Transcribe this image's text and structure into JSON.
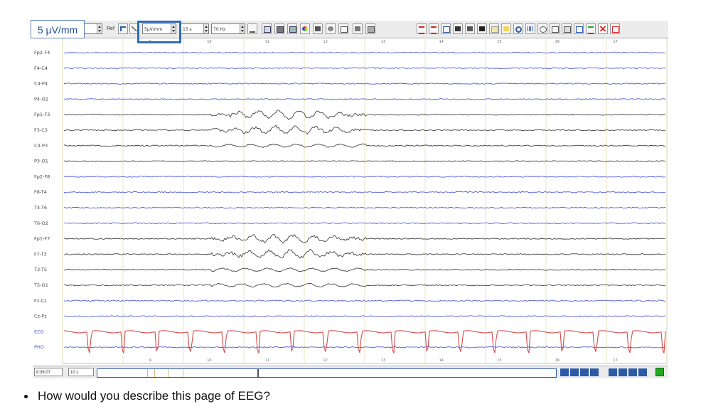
{
  "callout": {
    "sensitivity": "5 µV/mm"
  },
  "toolbar": {
    "ref_label": "Ref",
    "sensitivity_value": "5µV/mm",
    "timebase_value": "15 s",
    "filter_value": "70 Hz",
    "icons": [
      "ref-montage-icon",
      "electrode-icon",
      "page-view-icon",
      "split-view-icon",
      "grid-view-icon",
      "color-wheel-icon",
      "film-icon",
      "clock-icon",
      "edit-icon",
      "save-icon",
      "print-icon",
      "marker-red-icon",
      "marker-red2-icon",
      "channels-icon",
      "split-icon",
      "photo-icon",
      "event-icon",
      "copy-icon",
      "folder-icon",
      "search-icon",
      "bars-icon",
      "sphere-icon",
      "window-icon",
      "monitor-icon",
      "list-icon",
      "list2-icon",
      "close-red-icon",
      "info-icon"
    ]
  },
  "time_ticks": [
    "9",
    "10",
    "11",
    "12",
    "13",
    "14",
    "15",
    "16",
    "17"
  ],
  "channels": [
    {
      "label": "Fp2-F4",
      "color": "#5560d6"
    },
    {
      "label": "F4-C4",
      "color": "#5560d6"
    },
    {
      "label": "C4-P4",
      "color": "#5560d6"
    },
    {
      "label": "P4-O2",
      "color": "#5560d6"
    },
    {
      "label": "Fp1-F3",
      "color": "#444444"
    },
    {
      "label": "F3-C3",
      "color": "#444444"
    },
    {
      "label": "C3-P3",
      "color": "#444444"
    },
    {
      "label": "P3-O1",
      "color": "#444444"
    },
    {
      "label": "Fp2-F8",
      "color": "#5560d6"
    },
    {
      "label": "F8-T4",
      "color": "#5560d6"
    },
    {
      "label": "T4-T6",
      "color": "#5560d6"
    },
    {
      "label": "T6-O2",
      "color": "#5560d6"
    },
    {
      "label": "Fp1-F7",
      "color": "#444444"
    },
    {
      "label": "F7-T3",
      "color": "#444444"
    },
    {
      "label": "T3-T5",
      "color": "#444444"
    },
    {
      "label": "T5-O1",
      "color": "#444444"
    },
    {
      "label": "Fz-Cz",
      "color": "#5560d6"
    },
    {
      "label": "Cz-Pz",
      "color": "#5560d6"
    },
    {
      "label": "ECG",
      "color": "#d44a4a"
    },
    {
      "label": "PHO",
      "color": "#5560d6"
    }
  ],
  "status": {
    "clock": "8:36:07",
    "page_length": "10 s"
  },
  "question": "How would you describe this page of EEG?"
}
